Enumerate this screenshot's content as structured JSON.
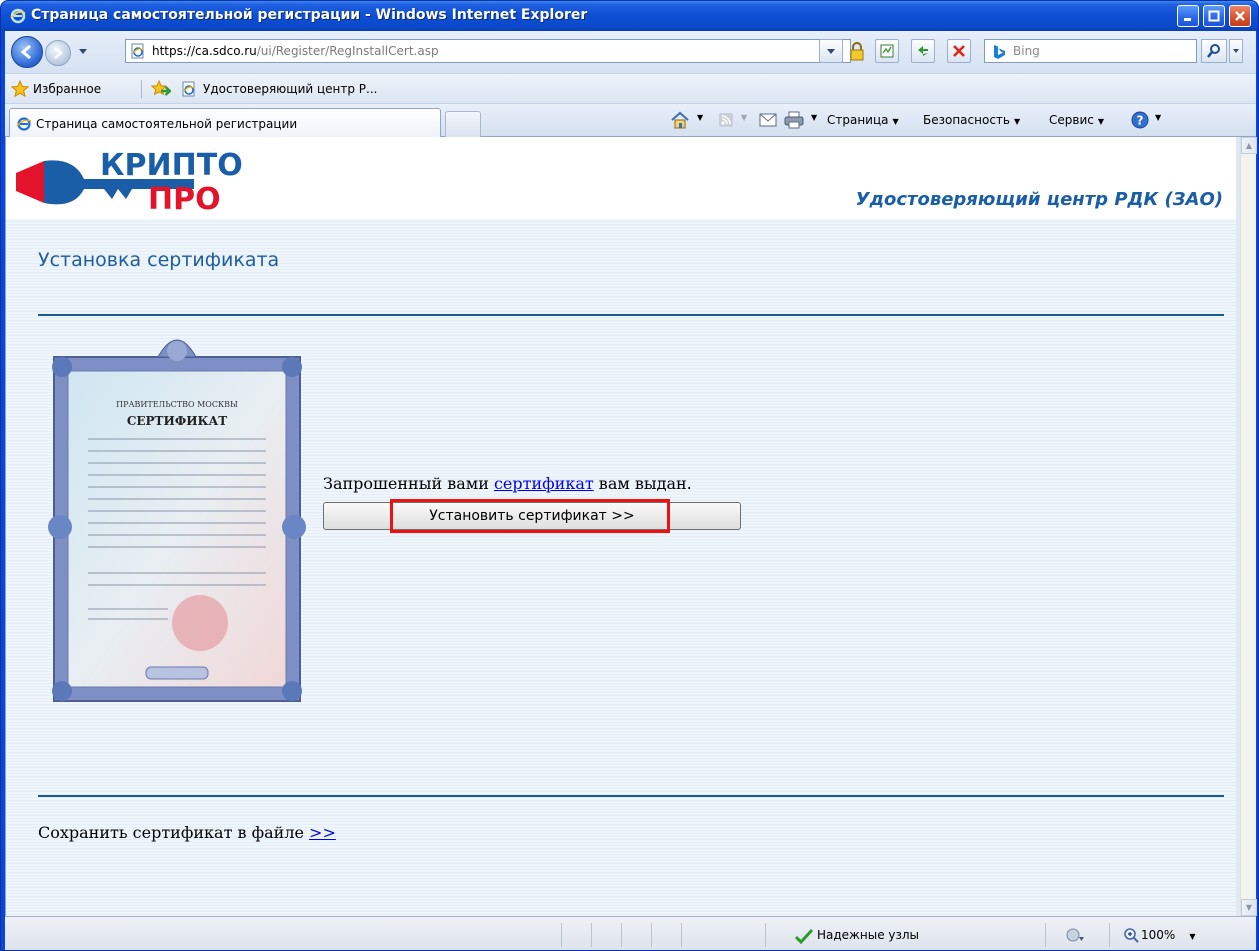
{
  "window": {
    "title": "Страница самостоятельной регистрации - Windows Internet Explorer"
  },
  "address_bar": {
    "url_host": "https://ca.sdco.ru",
    "url_path": "/ui/Register/RegInstallCert.asp",
    "search_placeholder": "Bing"
  },
  "favorites_bar": {
    "favorites_label": "Избранное",
    "link_label": "Удостоверяющий центр Р..."
  },
  "tabs": [
    {
      "label": "Страница самостоятельной регистрации"
    }
  ],
  "command_bar": {
    "page_label": "Страница",
    "security_label": "Безопасность",
    "tools_label": "Сервис"
  },
  "page": {
    "logo_top": "КРИПТО",
    "logo_bottom": "ПРО",
    "org_name": "Удостоверяющий центр РДК (ЗАО)",
    "section_title": "Установка сертификата",
    "message_before": "Запрошенный вами ",
    "message_link": "сертификат",
    "message_after": " вам выдан.",
    "install_button": "Установить сертификат >>",
    "save_text": "Сохранить сертификат в файле ",
    "save_link": ">>",
    "cert_image": {
      "heading": "ПРАВИТЕЛЬСТВО МОСКВЫ",
      "title": "СЕРТИФИКАТ"
    }
  },
  "status_bar": {
    "zone": "Надежные узлы",
    "zoom": "100%"
  },
  "colors": {
    "titlebar": "#0e4fd4",
    "accent_text": "#1f5c9b",
    "logo_blue": "#1b5ea8",
    "logo_red": "#e3132b",
    "highlight": "#ee1111"
  }
}
